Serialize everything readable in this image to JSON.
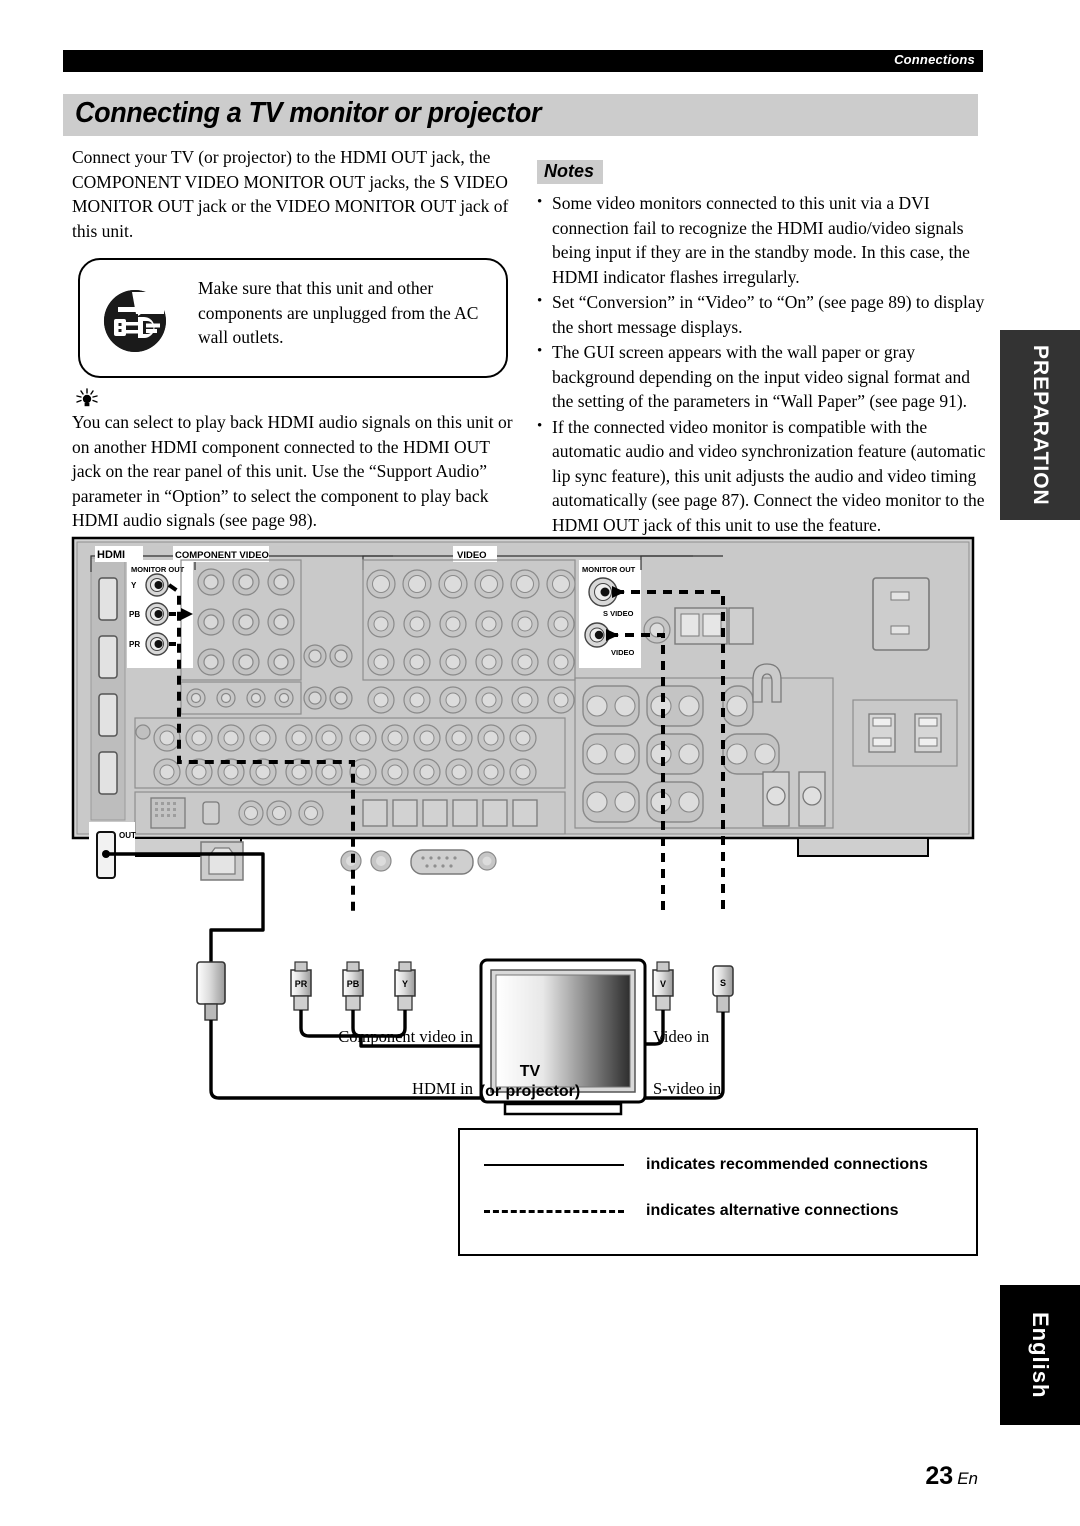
{
  "runhead": {
    "label": "Connections"
  },
  "title": "Connecting a TV monitor or projector",
  "left_column": {
    "intro": "Connect your TV (or projector) to the HDMI OUT jack, the COMPONENT VIDEO MONITOR OUT jacks, the S VIDEO MONITOR OUT jack or the VIDEO MONITOR OUT jack of this unit.",
    "warning": {
      "icon": "unplug-power-cord-icon",
      "text": "Make sure that this unit and other components are unplugged from the AC wall outlets."
    },
    "tip": {
      "icon": "lightbulb-tip-icon",
      "text": "You can select to play back HDMI audio signals on this unit or on another HDMI component connected to the HDMI OUT jack on the rear panel of this unit. Use the “Support Audio” parameter in “Option” to select the component to play back HDMI audio signals (see page 98)."
    }
  },
  "right_column": {
    "notes_heading": "Notes",
    "notes": [
      "Some video monitors connected to this unit via a DVI connection fail to recognize the HDMI audio/video signals being input if they are in the standby mode. In this case, the HDMI indicator flashes irregularly.",
      "Set “Conversion” in “Video” to “On” (see page 89) to display the short message displays.",
      "The GUI screen appears with the wall paper or gray background depending on the input video signal format and the setting of the parameters in “Wall Paper” (see page 91).",
      "If the connected video monitor is compatible with the automatic audio and video synchronization feature (automatic lip sync feature), this unit adjusts the audio and video timing automatically (see page 87). Connect the video monitor to the HDMI OUT jack of this unit to use the feature."
    ]
  },
  "side_tabs": {
    "preparation": "PREPARATION",
    "language": "English"
  },
  "diagram": {
    "rear_panel_labels": {
      "hdmi": "HDMI",
      "component_video": "COMPONENT VIDEO",
      "component_monitor_out": "MONITOR OUT",
      "component_y": "Y",
      "component_pb": "PB",
      "component_pr": "PR",
      "video": "VIDEO",
      "video_monitor_out": "MONITOR OUT",
      "s_video": "S VIDEO",
      "video_jack": "VIDEO",
      "hdmi_out": "OUT"
    },
    "cable_plugs": {
      "pr": "PR",
      "pb": "PB",
      "y": "Y",
      "v": "V",
      "s": "S"
    },
    "tv_labels": {
      "component_video_in": "Component video in",
      "hdmi_in": "HDMI in",
      "video_in": "Video in",
      "s_video_in": "S-video in",
      "device": "TV",
      "device_sub": "(or projector)"
    }
  },
  "legend": {
    "recommended": "indicates recommended connections",
    "alternative": "indicates alternative connections"
  },
  "footer": {
    "page": "23",
    "lang": "En"
  }
}
